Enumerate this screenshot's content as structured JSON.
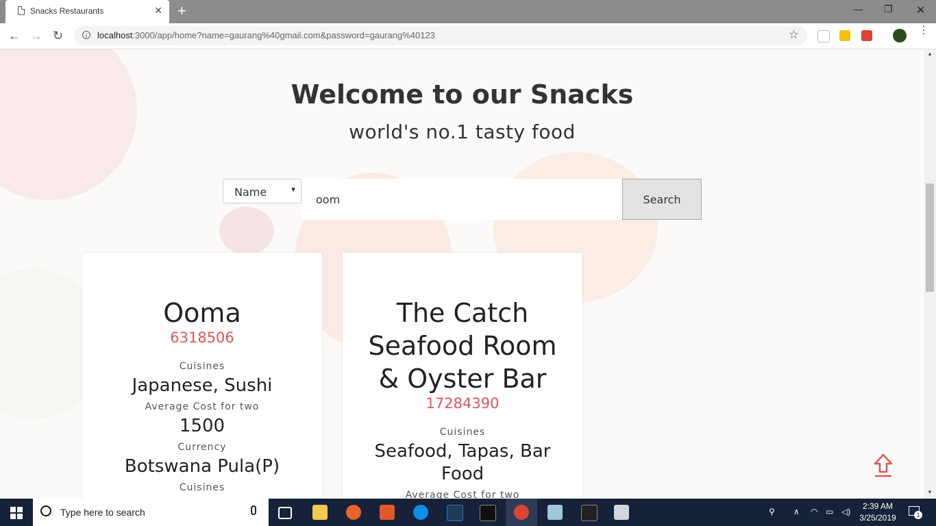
{
  "browser": {
    "tab_title": "Snacks Restaurants",
    "url_host": "localhost",
    "url_rest": ":3000/app/home?name=gaurang%40gmail.com&password=gaurang%40123"
  },
  "page": {
    "title": "Welcome to our Snacks",
    "subtitle": "world's no.1 tasty food",
    "search": {
      "filter_selected": "Name",
      "query": "oom",
      "button_label": "Search"
    },
    "cards": [
      {
        "name": "Ooma",
        "id": "6318506",
        "cuisines_label": "Cuisines",
        "cuisines": "Japanese, Sushi",
        "cost_label": "Average Cost for two",
        "cost": "1500",
        "currency_label": "Currency",
        "currency": "Botswana Pula(P)",
        "extra_label": "Cuisines"
      },
      {
        "name": "The Catch Seafood Room & Oyster Bar",
        "id": "17284390",
        "cuisines_label": "Cuisines",
        "cuisines": "Seafood, Tapas, Bar Food",
        "cost_label": "Average Cost for two"
      }
    ],
    "accent_color": "#e05555"
  },
  "taskbar": {
    "search_placeholder": "Type here to search",
    "time": "2:39 AM",
    "date": "3/25/2019",
    "notification_count": "1"
  }
}
